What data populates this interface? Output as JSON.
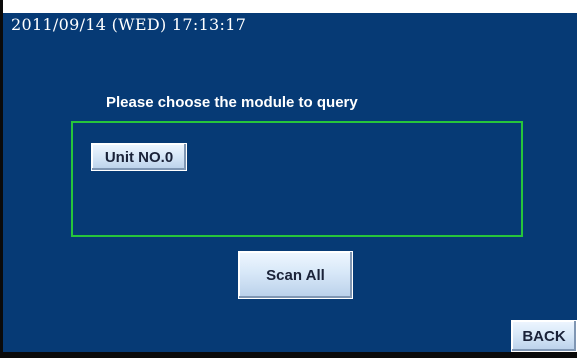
{
  "status": {
    "datetime": "2011/09/14 (WED) 17:13:17"
  },
  "main": {
    "prompt": "Please choose the module to query",
    "modules": [
      {
        "label": "Unit NO.0"
      }
    ],
    "scan_all_label": "Scan All"
  },
  "footer": {
    "back_label": "BACK"
  },
  "colors": {
    "screen_background": "#063a75",
    "module_box_border": "#27c53b",
    "text": "#ffffff"
  }
}
